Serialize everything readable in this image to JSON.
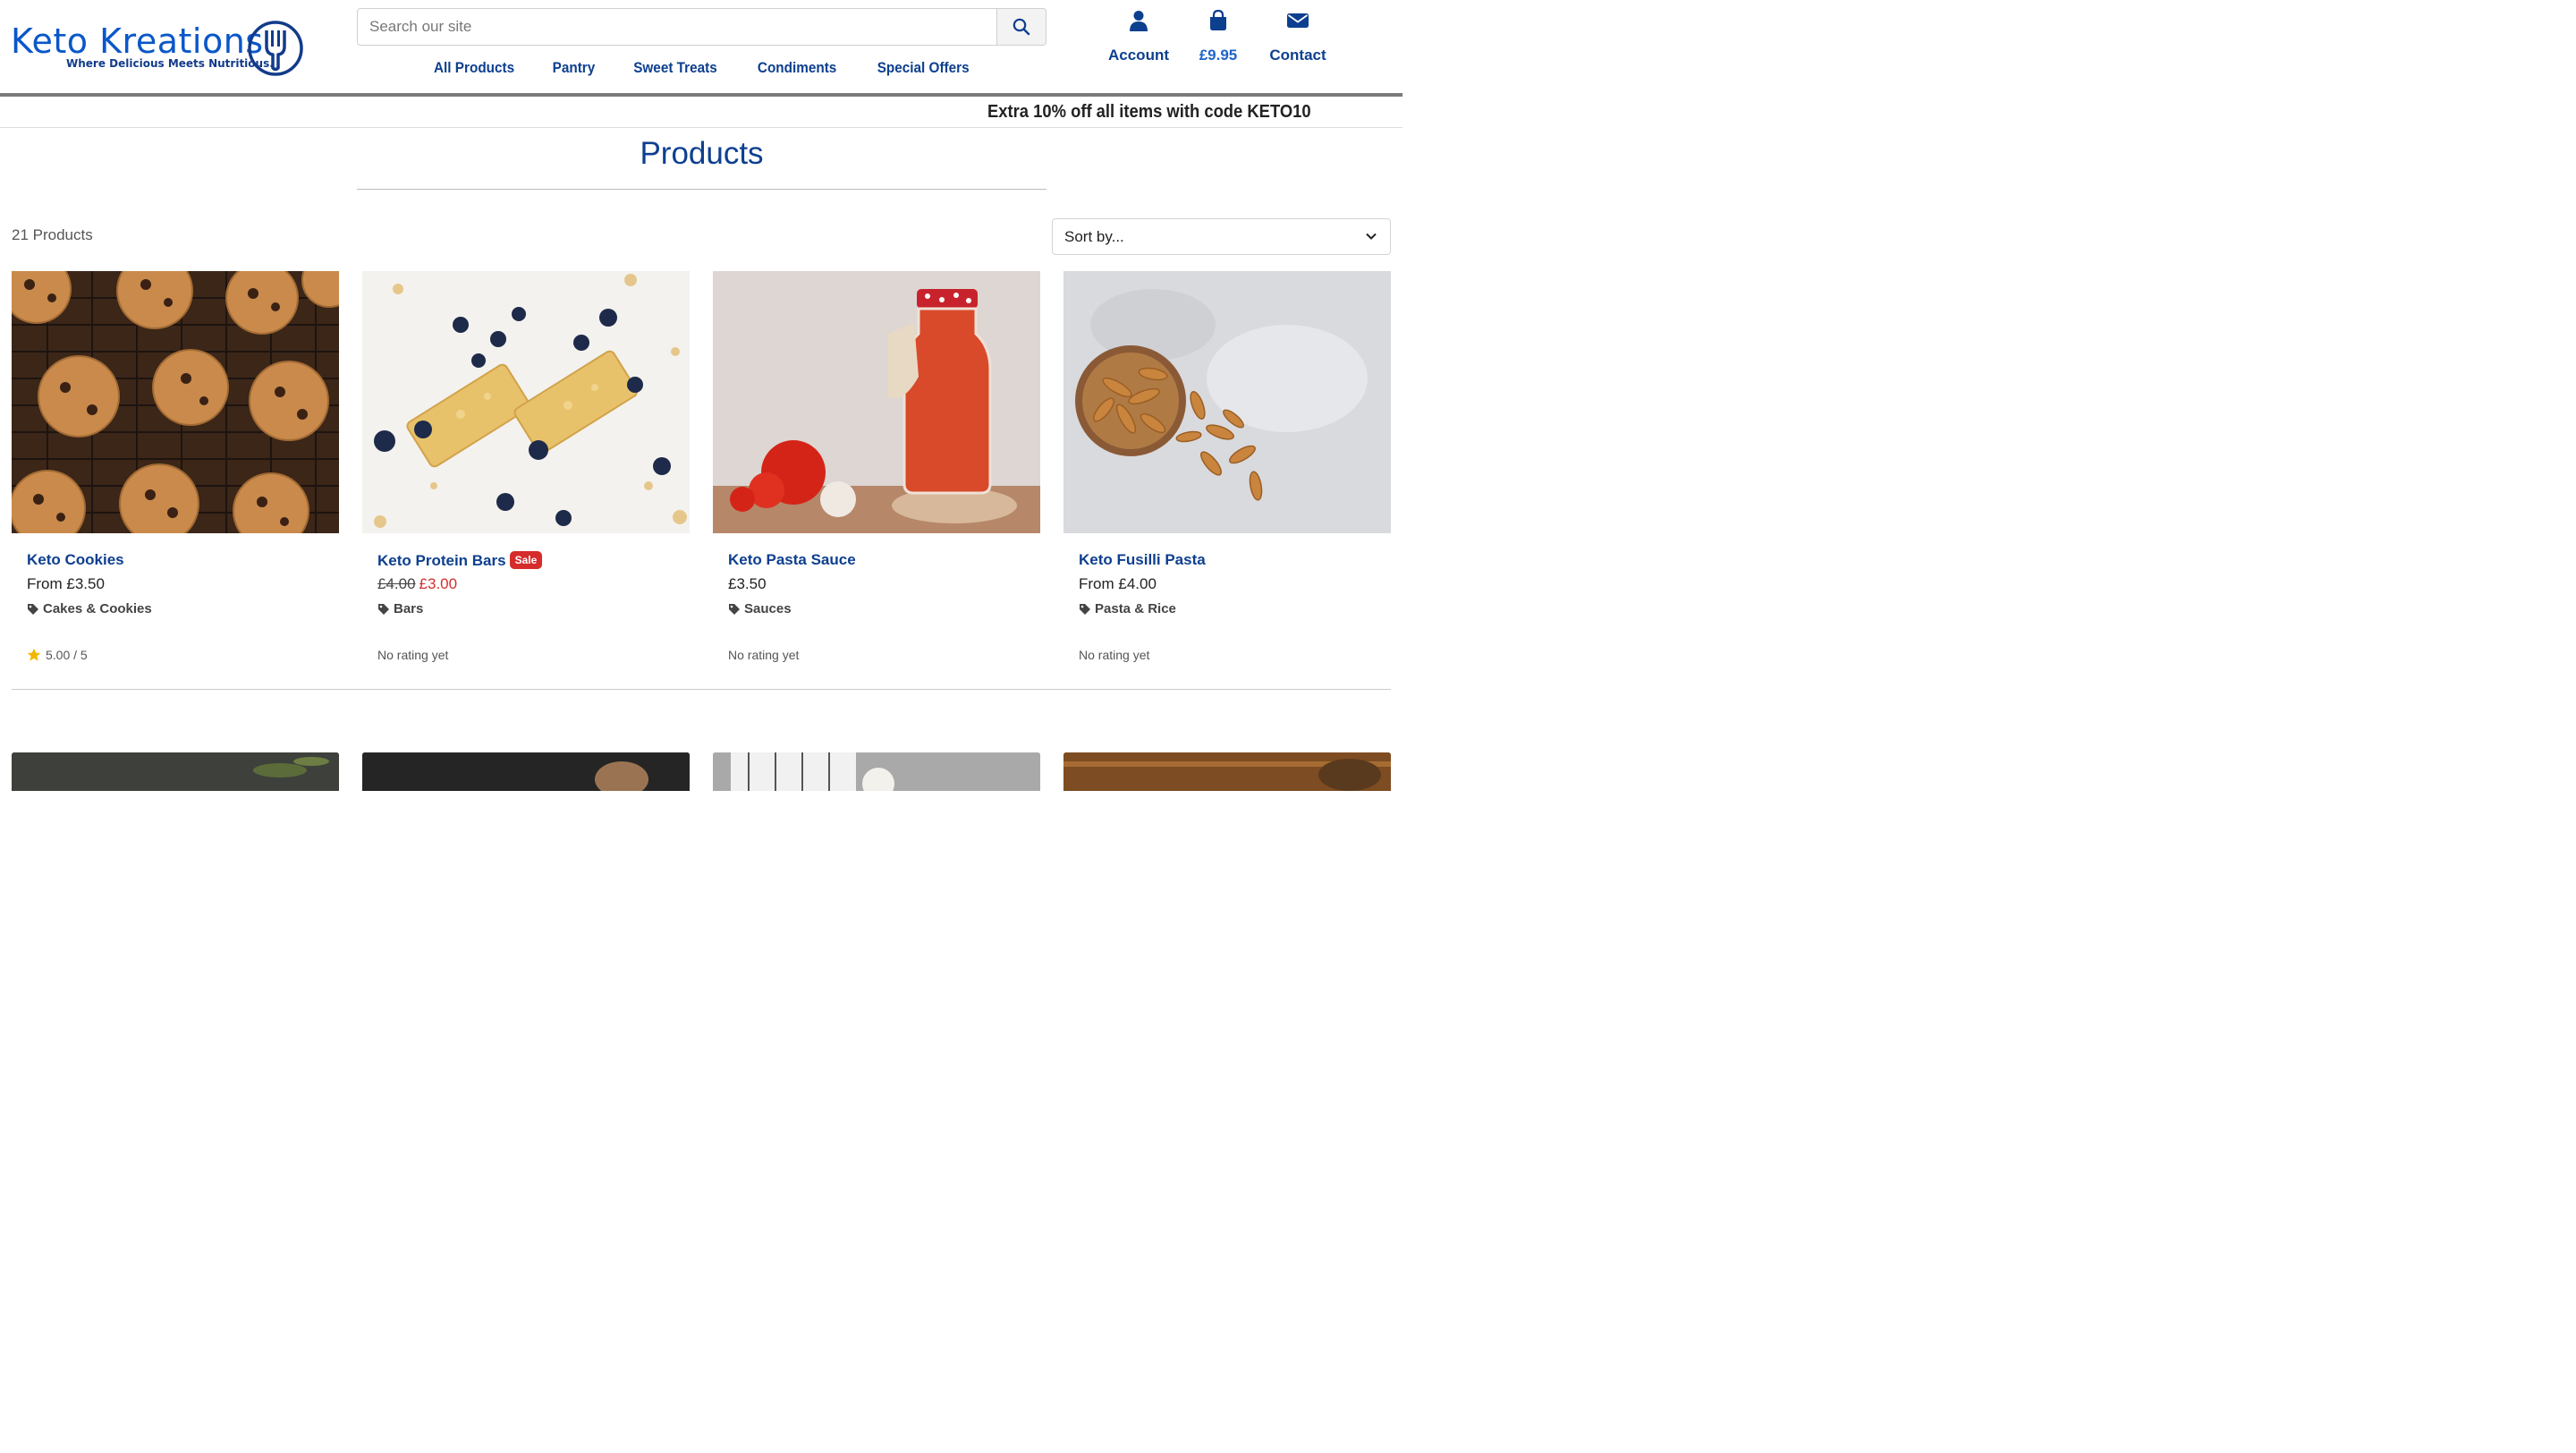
{
  "header": {
    "logo": {
      "wordmark": "Keto Kreations",
      "tagline": "Where Delicious Meets Nutritious."
    },
    "search": {
      "placeholder": "Search our site",
      "button_icon": "search-icon"
    },
    "nav": [
      {
        "label": "All Products"
      },
      {
        "label": "Pantry"
      },
      {
        "label": "Sweet Treats"
      },
      {
        "label": "Condiments"
      },
      {
        "label": "Special Offers"
      }
    ],
    "actions": {
      "account": {
        "label": "Account",
        "icon": "user-icon"
      },
      "cart": {
        "label": "£9.95",
        "icon": "shopping-bag-icon"
      },
      "contact": {
        "label": "Contact",
        "icon": "envelope-icon"
      }
    }
  },
  "promo": {
    "text": "Extra 10% off all items with code KETO10"
  },
  "page": {
    "title": "Products",
    "count": "21 Products",
    "sort": {
      "selected": "Sort by..."
    }
  },
  "products": [
    {
      "name": "Keto Cookies",
      "price": "From £3.50",
      "category": "Cakes & Cookies",
      "rating": "5.00 / 5",
      "image": "cookies on cooling rack"
    },
    {
      "name": "Keto Protein Bars",
      "badge": "Sale",
      "old_price": "£4.00",
      "price": "£3.00",
      "category": "Bars",
      "rating": "No rating yet",
      "image": "protein bars with blueberries"
    },
    {
      "name": "Keto Pasta Sauce",
      "price": "£3.50",
      "category": "Sauces",
      "rating": "No rating yet",
      "image": "pasta sauce jar with tomatoes"
    },
    {
      "name": "Keto Fusilli Pasta",
      "price": "From £4.00",
      "category": "Pasta & Rice",
      "rating": "No rating yet",
      "image": "fusilli pasta bowl"
    }
  ],
  "colors": {
    "brand_blue": "#0d3f8f",
    "logo_blue": "#0a57c9",
    "sale_red": "#d62c2c",
    "star": "#f2b705"
  }
}
